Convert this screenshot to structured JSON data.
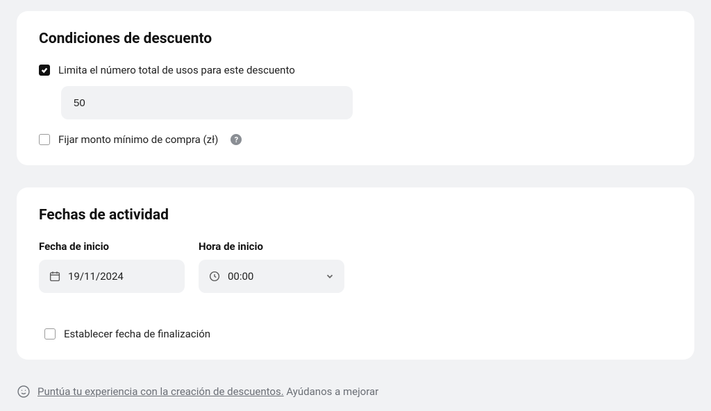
{
  "conditions": {
    "title": "Condiciones de descuento",
    "limitUses": {
      "checked": true,
      "label": "Limita el número total de usos para este descuento",
      "value": "50"
    },
    "minAmount": {
      "checked": false,
      "label": "Fijar monto mínimo de compra (zł)"
    }
  },
  "dates": {
    "title": "Fechas de actividad",
    "startDateLabel": "Fecha de inicio",
    "startDateValue": "19/11/2024",
    "startTimeLabel": "Hora de inicio",
    "startTimeValue": "00:00",
    "setEndDate": {
      "checked": false,
      "label": "Establecer fecha de finalización"
    }
  },
  "feedback": {
    "link": "Puntúa tu experiencia con la creación de descuentos.",
    "suffix": " Ayúdanos a mejorar"
  }
}
